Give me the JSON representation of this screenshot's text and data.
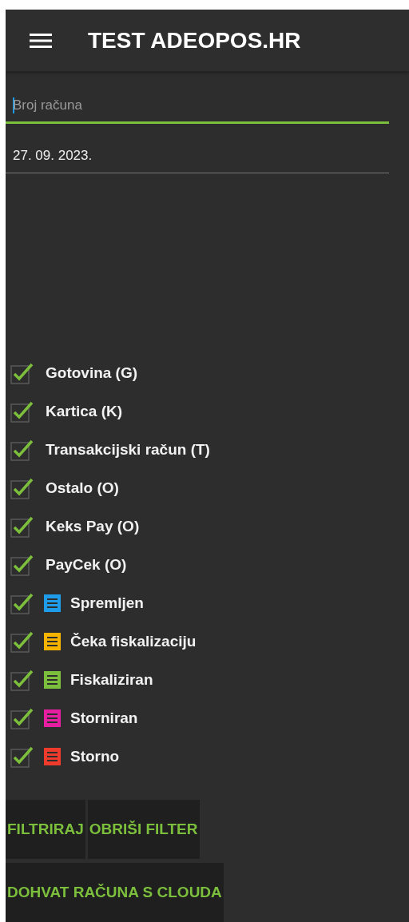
{
  "app_bar": {
    "title": "TEST ADEOPOS.HR"
  },
  "fields": [
    {
      "kind": "text",
      "placeholder": "Broj računa",
      "focused": true
    },
    {
      "kind": "date",
      "value": "27. 09. 2023.",
      "focused": false
    }
  ],
  "payment_types": [
    {
      "label": "Gotovina (G)",
      "checked": true
    },
    {
      "label": "Kartica (K)",
      "checked": true
    },
    {
      "label": "Transakcijski račun (T)",
      "checked": true
    },
    {
      "label": "Ostalo (O)",
      "checked": true
    },
    {
      "label": "Keks Pay (O)",
      "checked": true
    },
    {
      "label": "PayCek (O)",
      "checked": true
    }
  ],
  "statuses": [
    {
      "label": "Spremljen",
      "checked": true,
      "color": "#1e9be9"
    },
    {
      "label": "Čeka fiskalizaciju",
      "checked": true,
      "color": "#f6b400"
    },
    {
      "label": "Fiskaliziran",
      "checked": true,
      "color": "#7cbf3c"
    },
    {
      "label": "Storniran",
      "checked": true,
      "color": "#e61ea0"
    },
    {
      "label": "Storno",
      "checked": true,
      "color": "#ee3b2c"
    }
  ],
  "buttons": [
    [
      "FILTRIRAJ",
      "OBRIŠI FILTER"
    ],
    [
      "DOHVAT RAČUNA S CLOUDA"
    ]
  ]
}
